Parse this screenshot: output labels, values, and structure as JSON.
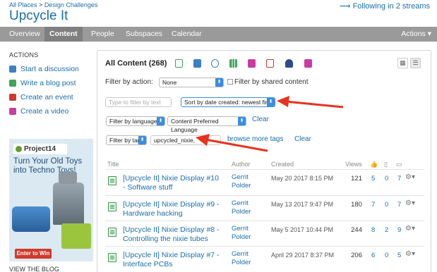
{
  "header": {
    "breadcrumb_root": "All Places",
    "breadcrumb_sep": ">",
    "breadcrumb_current": "Design Challenges",
    "place_title": "Upcycle It",
    "following": "Following in 2 streams"
  },
  "nav": {
    "tabs": [
      {
        "label": "Overview"
      },
      {
        "label": "Content"
      },
      {
        "label": "People"
      },
      {
        "label": "Subspaces"
      },
      {
        "label": "Calendar"
      }
    ],
    "actions": "Actions"
  },
  "sidebar": {
    "heading": "ACTIONS",
    "items": [
      {
        "label": "Start a discussion",
        "color": "#3b7fc4"
      },
      {
        "label": "Write a blog post",
        "color": "#3aa657"
      },
      {
        "label": "Create an event",
        "color": "#d0392b"
      },
      {
        "label": "Create a video",
        "color": "#c93ba0"
      }
    ],
    "ad": {
      "brand": "Project14",
      "headline_1": "Turn Your Old Toys",
      "headline_2": "into Techno Toys!",
      "cta": "Enter to Win"
    },
    "view_blog": "VIEW THE BLOG"
  },
  "content": {
    "title": "All Content (268)",
    "filter_action_label": "Filter by action:",
    "filter_action_value": "None",
    "filter_shared_label": "Filter by shared content",
    "text_filter_placeholder": "Type to filter by text",
    "sort_value": "Sort by date created: newest first",
    "filter_language_label": "Filter by language",
    "language_value": "Content Preferred Language",
    "clear_1": "Clear",
    "filter_tag_label": "Filter by tag",
    "tag_value": "upcycled_nixie,",
    "browse_tags": "browse more tags",
    "clear_2": "Clear"
  },
  "table": {
    "headers": {
      "title": "Title",
      "author": "Author",
      "created": "Created",
      "views": "Views"
    },
    "rows": [
      {
        "title_1": "[Upcycle It] Nixie Display #10",
        "title_2": "- Software stuff",
        "author_1": "Gerrit",
        "author_2": "Polder",
        "created": "May 20 2017 8:15 PM",
        "views": "121",
        "likes": "5",
        "bookmarks": "0",
        "comments": "7"
      },
      {
        "title_1": "[Upcycle It] Nixie Display #9 -",
        "title_2": "Hardware hacking",
        "author_1": "Gerrit",
        "author_2": "Polder",
        "created": "May 13 2017 9:47 PM",
        "views": "180",
        "likes": "7",
        "bookmarks": "0",
        "comments": "7"
      },
      {
        "title_1": "[Upcycle It] Nixie Display #8 -",
        "title_2": "Controlling the nixie tubes",
        "author_1": "Gerrit",
        "author_2": "Polder",
        "created": "May 5 2017 10:44 PM",
        "views": "244",
        "likes": "8",
        "bookmarks": "2",
        "comments": "9"
      },
      {
        "title_1": "[Upcycle It] Nixie Display #7 -",
        "title_2": "Interface PCBs",
        "author_1": "Gerrit",
        "author_2": "Polder",
        "created": "April 29 2017 8:37 PM",
        "views": "206",
        "likes": "6",
        "bookmarks": "0",
        "comments": "5"
      }
    ]
  },
  "colors": {
    "accent": "#1a6ea8",
    "nav_bg": "#9a9a9a",
    "annotation_arrow": "#e8321e"
  }
}
